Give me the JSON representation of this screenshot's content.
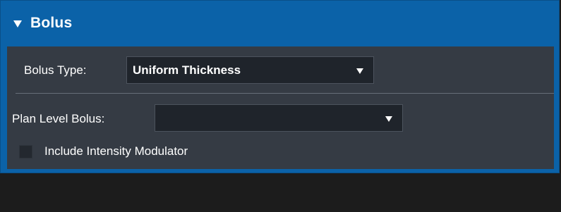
{
  "panel": {
    "title": "Bolus",
    "expanded": true,
    "accent_color": "#0b62a8"
  },
  "bolus_type": {
    "label": "Bolus Type:",
    "selected": "Uniform Thickness"
  },
  "plan_level_bolus": {
    "label": "Plan Level Bolus:",
    "selected": ""
  },
  "include_intensity_modulator": {
    "label": "Include Intensity Modulator",
    "checked": false
  }
}
